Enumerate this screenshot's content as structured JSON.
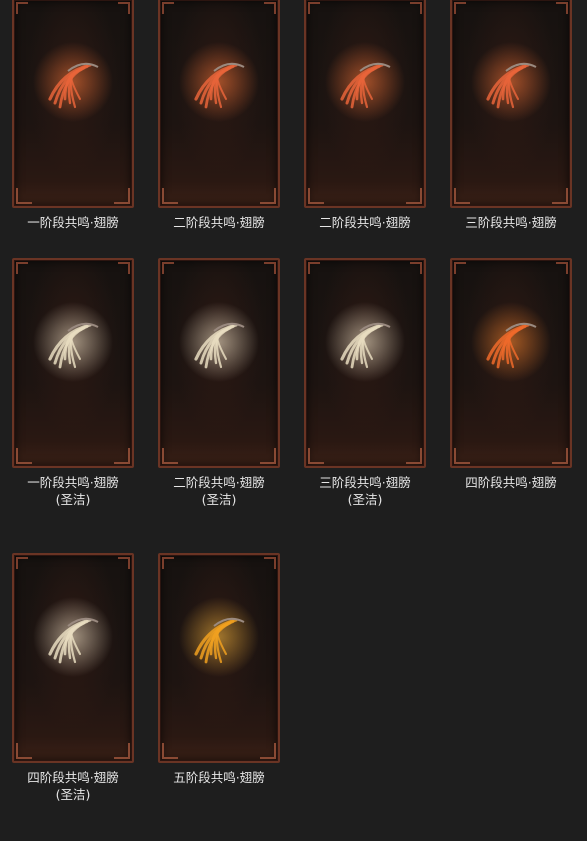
{
  "items": [
    {
      "name": "一阶段共鸣·翅膀",
      "sub": "",
      "color": "#e8643a",
      "glow": "#ff7a3a"
    },
    {
      "name": "二阶段共鸣·翅膀",
      "sub": "",
      "color": "#e8643a",
      "glow": "#ff7a3a"
    },
    {
      "name": "二阶段共鸣·翅膀",
      "sub": "",
      "color": "#e8643a",
      "glow": "#ff7a3a"
    },
    {
      "name": "三阶段共鸣·翅膀",
      "sub": "",
      "color": "#e8643a",
      "glow": "#ff7a3a"
    },
    {
      "name": "一阶段共鸣·翅膀",
      "sub": "(圣洁)",
      "color": "#e8dcc0",
      "glow": "#fff3d6"
    },
    {
      "name": "二阶段共鸣·翅膀",
      "sub": "(圣洁)",
      "color": "#e8dcc0",
      "glow": "#fff3d6"
    },
    {
      "name": "三阶段共鸣·翅膀",
      "sub": "(圣洁)",
      "color": "#e8dcc0",
      "glow": "#fff3d6"
    },
    {
      "name": "四阶段共鸣·翅膀",
      "sub": "",
      "color": "#ee6a2a",
      "glow": "#ff8a30"
    },
    {
      "name": "四阶段共鸣·翅膀",
      "sub": "(圣洁)",
      "color": "#e8dcc0",
      "glow": "#fff3d6"
    },
    {
      "name": "五阶段共鸣·翅膀",
      "sub": "",
      "color": "#f0a020",
      "glow": "#ffc040"
    }
  ]
}
